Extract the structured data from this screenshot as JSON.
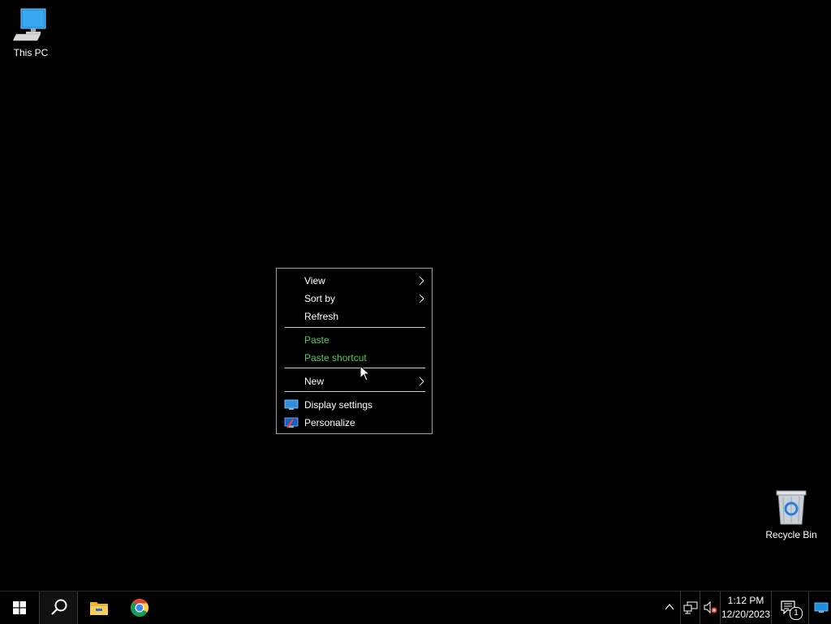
{
  "desktop": {
    "icons": [
      {
        "label": "This PC",
        "icon": "computer-icon"
      },
      {
        "label": "Recycle Bin",
        "icon": "recycle-bin-icon"
      }
    ],
    "background_color": "#000000"
  },
  "context_menu": {
    "items": [
      {
        "label": "View",
        "submenu": true,
        "enabled": true
      },
      {
        "label": "Sort by",
        "submenu": true,
        "enabled": true
      },
      {
        "label": "Refresh",
        "submenu": false,
        "enabled": true
      },
      {
        "label": "Paste",
        "submenu": false,
        "enabled": false
      },
      {
        "label": "Paste shortcut",
        "submenu": false,
        "enabled": false
      },
      {
        "label": "New",
        "submenu": true,
        "enabled": true
      },
      {
        "label": "Display settings",
        "submenu": false,
        "enabled": true,
        "icon": "display-settings-icon"
      },
      {
        "label": "Personalize",
        "submenu": false,
        "enabled": true,
        "icon": "personalize-icon"
      }
    ],
    "disabled_color": "#58c85a"
  },
  "taskbar": {
    "pinned": [
      {
        "name": "start",
        "icon": "windows-logo-icon"
      },
      {
        "name": "search",
        "icon": "search-icon"
      },
      {
        "name": "file-explorer",
        "icon": "folder-icon"
      },
      {
        "name": "chrome",
        "icon": "chrome-icon"
      }
    ],
    "tray": {
      "time": "1:12 PM",
      "date": "12/20/2023",
      "notification_count": "1",
      "icons": [
        "chevron-up-icon",
        "network-icon",
        "volume-muted-icon"
      ]
    }
  }
}
